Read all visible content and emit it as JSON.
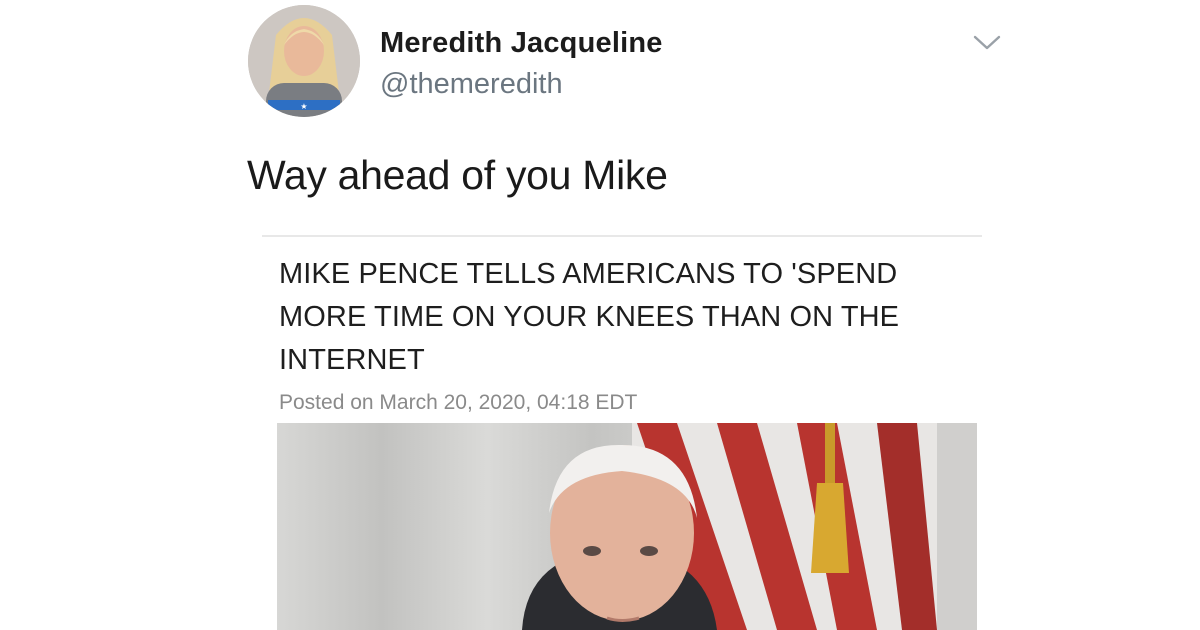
{
  "tweet": {
    "author_name": "Meredith Jacqueline",
    "author_handle": "@themeredith",
    "text": "Way ahead of you Mike",
    "menu_icon": "chevron-down-icon"
  },
  "card": {
    "headline": "MIKE PENCE TELLS AMERICANS TO 'SPEND MORE TIME ON YOUR KNEES THAN ON THE INTERNET",
    "posted": "Posted on March 20, 2020, 04:18 EDT"
  },
  "colors": {
    "name": "#1c1c1c",
    "handle": "#6b7680",
    "posted": "#8a8a8a",
    "flag_red": "#b8342f",
    "tassel": "#d8a830"
  }
}
